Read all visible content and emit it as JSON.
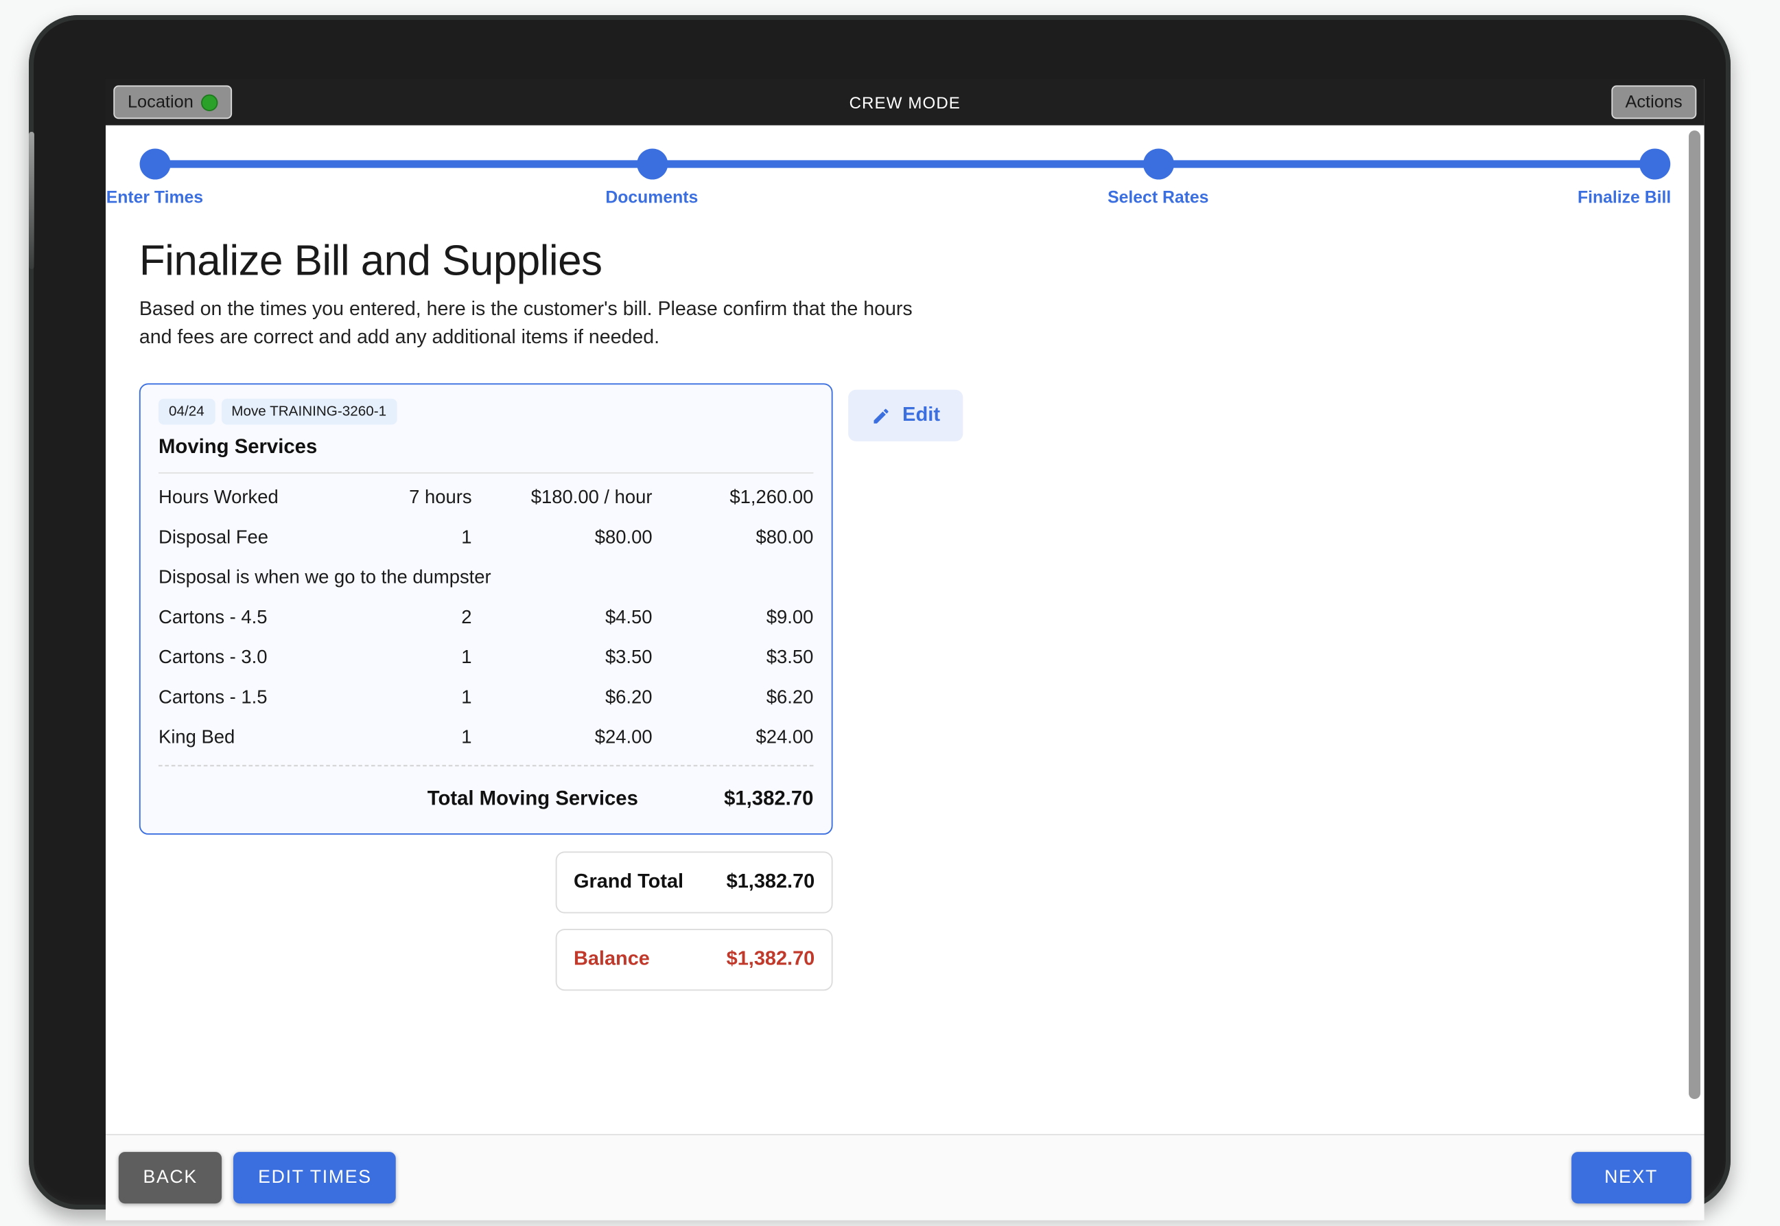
{
  "topbar": {
    "location_label": "Location",
    "location_status_color": "#2aa22a",
    "title": "CREW MODE",
    "actions_label": "Actions"
  },
  "stepper": {
    "accent_color": "#3b6fe0",
    "steps": [
      {
        "label": "Enter Times",
        "position_pct": 0
      },
      {
        "label": "Documents",
        "position_pct": 33.3
      },
      {
        "label": "Select Rates",
        "position_pct": 66.7
      },
      {
        "label": "Finalize Bill",
        "position_pct": 100
      }
    ]
  },
  "page": {
    "title": "Finalize Bill and Supplies",
    "subtitle": "Based on the times you entered, here is the customer's bill. Please confirm that the hours and fees are correct and add any additional items if needed."
  },
  "bill": {
    "badges": [
      "04/24",
      "Move TRAINING-3260-1"
    ],
    "section_title": "Moving Services",
    "line_items": [
      {
        "description": "Hours Worked",
        "qty": "7 hours",
        "rate": "$180.00 / hour",
        "amount": "$1,260.00",
        "note": ""
      },
      {
        "description": "Disposal Fee",
        "qty": "1",
        "rate": "$80.00",
        "amount": "$80.00",
        "note": "Disposal is when we go to the dumpster"
      },
      {
        "description": "Cartons - 4.5",
        "qty": "2",
        "rate": "$4.50",
        "amount": "$9.00",
        "note": ""
      },
      {
        "description": "Cartons - 3.0",
        "qty": "1",
        "rate": "$3.50",
        "amount": "$3.50",
        "note": ""
      },
      {
        "description": "Cartons - 1.5",
        "qty": "1",
        "rate": "$6.20",
        "amount": "$6.20",
        "note": ""
      },
      {
        "description": "King Bed",
        "qty": "1",
        "rate": "$24.00",
        "amount": "$24.00",
        "note": ""
      }
    ],
    "total_label": "Total Moving Services",
    "total_value": "$1,382.70",
    "edit_label": "Edit",
    "card_border_color": "#3b6fe0"
  },
  "summary": {
    "grand_total_label": "Grand Total",
    "grand_total_value": "$1,382.70",
    "balance_label": "Balance",
    "balance_value": "$1,382.70",
    "balance_color": "#c0392b"
  },
  "bottombar": {
    "back_label": "BACK",
    "edit_times_label": "EDIT TIMES",
    "next_label": "NEXT"
  }
}
